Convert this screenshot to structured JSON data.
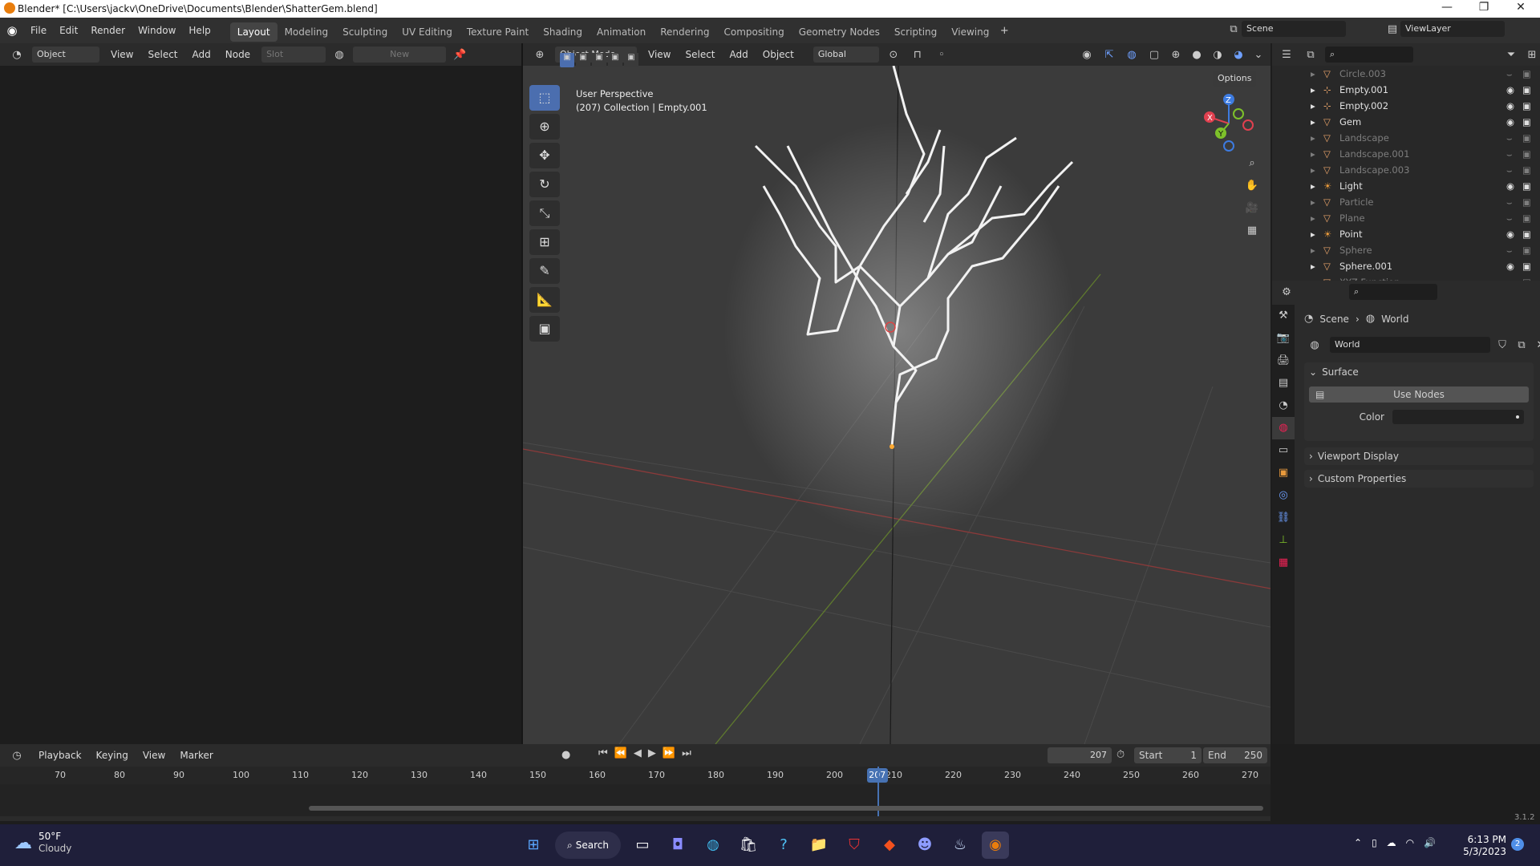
{
  "window": {
    "title": "Blender* [C:\\Users\\jackv\\OneDrive\\Documents\\Blender\\ShatterGem.blend]",
    "min": "—",
    "max": "❐",
    "close": "✕"
  },
  "menus": [
    "File",
    "Edit",
    "Render",
    "Window",
    "Help"
  ],
  "workspaces": [
    "Layout",
    "Modeling",
    "Sculpting",
    "UV Editing",
    "Texture Paint",
    "Shading",
    "Animation",
    "Rendering",
    "Compositing",
    "Geometry Nodes",
    "Scripting",
    "Viewing"
  ],
  "active_workspace": "Layout",
  "scene": {
    "label": "Scene",
    "viewlayer": "ViewLayer"
  },
  "left_header": {
    "mode": "Object",
    "items": [
      "View",
      "Select",
      "Add",
      "Node"
    ],
    "slot": "Slot",
    "new": "New"
  },
  "viewport": {
    "mode": "Object Mode",
    "menus": [
      "View",
      "Select",
      "Add",
      "Object"
    ],
    "orientation": "Global",
    "options": "Options",
    "overlay_title": "User Perspective",
    "overlay_sub": "(207) Collection | Empty.001"
  },
  "outliner": {
    "rows": [
      {
        "name": "Circle.003",
        "dim": true,
        "type": "mesh"
      },
      {
        "name": "Empty.001",
        "dim": false,
        "type": "empty"
      },
      {
        "name": "Empty.002",
        "dim": false,
        "type": "empty"
      },
      {
        "name": "Gem",
        "dim": false,
        "type": "mesh"
      },
      {
        "name": "Landscape",
        "dim": true,
        "type": "mesh"
      },
      {
        "name": "Landscape.001",
        "dim": true,
        "type": "mesh"
      },
      {
        "name": "Landscape.003",
        "dim": true,
        "type": "mesh"
      },
      {
        "name": "Light",
        "dim": false,
        "type": "light"
      },
      {
        "name": "Particle",
        "dim": true,
        "type": "mesh"
      },
      {
        "name": "Plane",
        "dim": true,
        "type": "mesh"
      },
      {
        "name": "Point",
        "dim": false,
        "type": "light"
      },
      {
        "name": "Sphere",
        "dim": true,
        "type": "mesh"
      },
      {
        "name": "Sphere.001",
        "dim": false,
        "type": "mesh"
      },
      {
        "name": "XYZ Function",
        "dim": true,
        "type": "mesh"
      }
    ]
  },
  "properties": {
    "breadcrumb_scene": "Scene",
    "breadcrumb_world": "World",
    "world_name": "World",
    "surface": "Surface",
    "use_nodes": "Use Nodes",
    "color_label": "Color",
    "viewport_display": "Viewport Display",
    "custom_properties": "Custom Properties"
  },
  "timeline": {
    "menus": [
      "Playback",
      "Keying",
      "View",
      "Marker"
    ],
    "current_frame": "207",
    "start_label": "Start",
    "start": "1",
    "end_label": "End",
    "end": "250",
    "ticks": [
      "70",
      "80",
      "90",
      "100",
      "110",
      "120",
      "130",
      "140",
      "150",
      "160",
      "170",
      "180",
      "190",
      "200",
      "210",
      "220",
      "230",
      "240",
      "250",
      "260",
      "270"
    ],
    "version": "3.1.2"
  },
  "taskbar": {
    "temp": "50°F",
    "weather": "Cloudy",
    "search": "Search",
    "time": "6:13 PM",
    "date": "5/3/2023",
    "badge": "2"
  },
  "colors": {
    "accent": "#4b6eaf",
    "frame": "#4772b3",
    "x_axis": "#e0404f",
    "y_axis": "#7ec12a",
    "z_axis": "#3d7be0"
  }
}
